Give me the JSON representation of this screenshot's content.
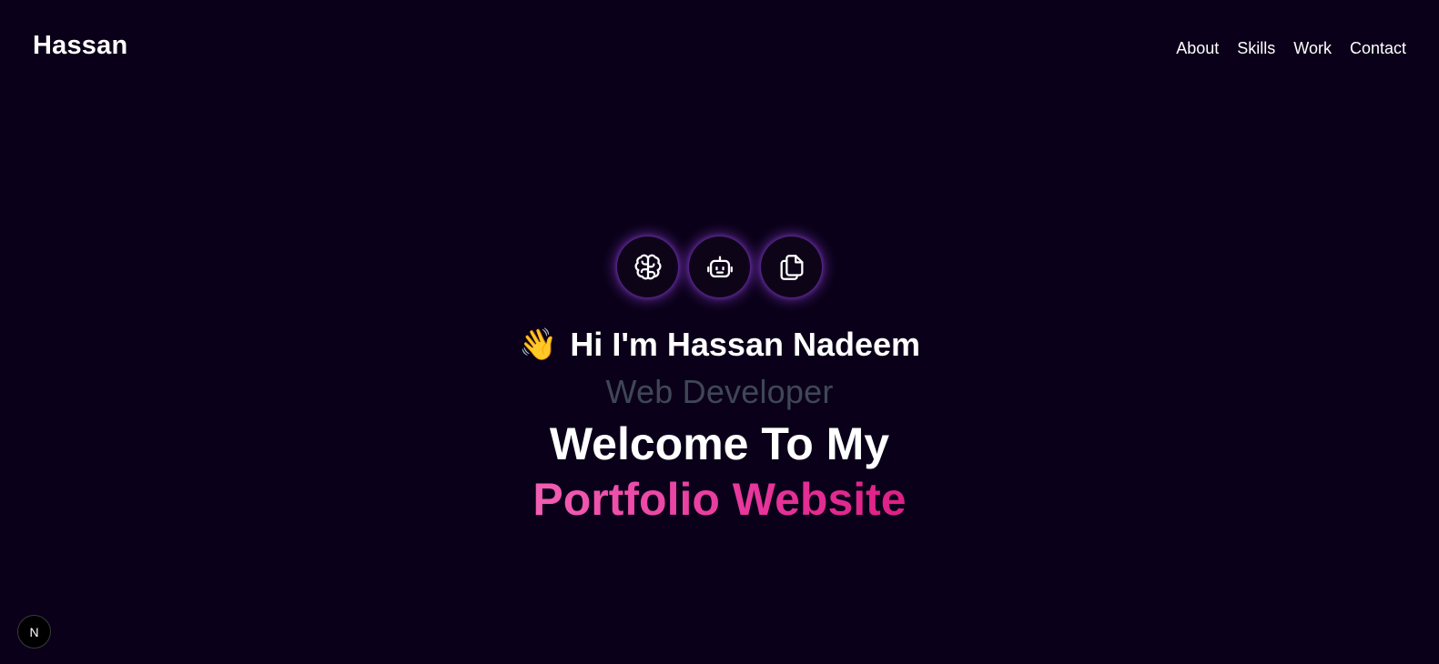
{
  "header": {
    "brand": "Hassan",
    "nav": [
      "About",
      "Skills",
      "Work",
      "Contact"
    ]
  },
  "hero": {
    "icons": [
      "brain-icon",
      "robot-icon",
      "copy-icon"
    ],
    "wave_emoji": "👋",
    "greeting": "Hi I'm Hassan Nadeem",
    "role": "Web Developer",
    "headline": "Welcome To My",
    "headline_accent": "Portfolio Website"
  },
  "dev_badge": {
    "label": "N"
  },
  "colors": {
    "background": "#0b0019",
    "accent_start": "#f15fb3",
    "accent_end": "#dd1f85",
    "icon_glow": "#9646e6",
    "role_text": "#3f4757"
  }
}
